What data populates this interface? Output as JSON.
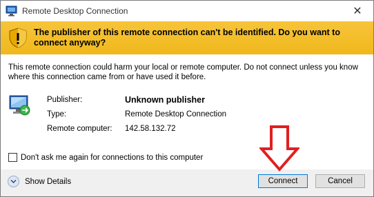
{
  "window": {
    "title": "Remote Desktop Connection",
    "icon": "remote-desktop-icon",
    "close_glyph": "✕"
  },
  "banner": {
    "icon": "shield-warning-icon",
    "text": "The publisher of this remote connection can't be identified. Do you want to connect anyway?",
    "color": "#f3bd2c"
  },
  "warning": {
    "text": "This remote connection could harm your local or remote computer. Do not connect unless you know where this connection came from or have used it before."
  },
  "details": {
    "icon": "computer-icon",
    "publisher_label": "Publisher:",
    "publisher_value": "Unknown publisher",
    "type_label": "Type:",
    "type_value": "Remote Desktop Connection",
    "remote_label": "Remote computer:",
    "remote_value": "142.58.132.72"
  },
  "checkbox": {
    "label": "Don't ask me again for connections to this computer",
    "checked": false
  },
  "footer": {
    "show_details_label": "Show Details",
    "connect_label": "Connect",
    "cancel_label": "Cancel"
  },
  "annotation": {
    "arrow_color": "#e02020",
    "arrow_icon": "red-down-arrow-icon"
  }
}
